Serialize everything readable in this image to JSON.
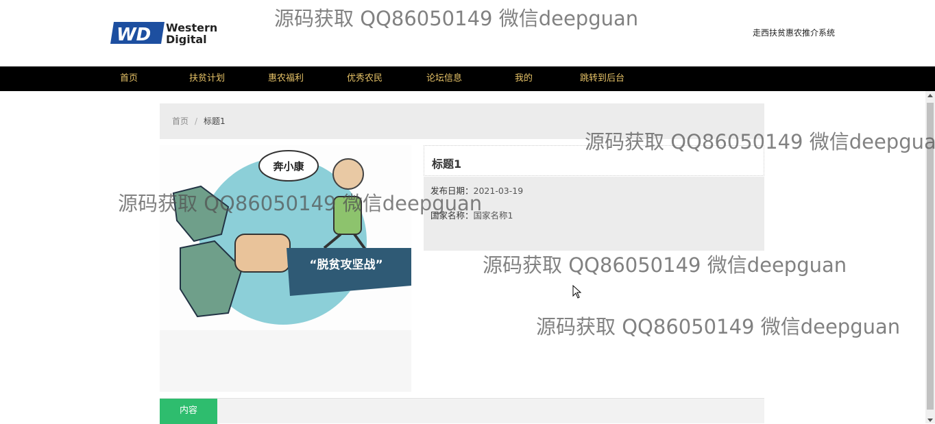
{
  "header": {
    "logo": {
      "line1": "Western",
      "line2": "Digital",
      "mark": "WD"
    },
    "site_title": "走西扶贫惠农推介系统"
  },
  "nav": {
    "items": [
      {
        "label": "首页"
      },
      {
        "label": "扶贫计划"
      },
      {
        "label": "惠农福利"
      },
      {
        "label": "优秀农民"
      },
      {
        "label": "论坛信息"
      },
      {
        "label": "我的"
      },
      {
        "label": "跳转到后台"
      }
    ]
  },
  "breadcrumb": {
    "home": "首页",
    "separator": "/",
    "current": "标题1"
  },
  "image": {
    "bubble_text": "奔小康",
    "banner_text": "“脱贫攻坚战”"
  },
  "detail": {
    "title": "标题1",
    "fields": [
      {
        "label": "发布日期：",
        "value": "2021-03-19"
      },
      {
        "label": "国家名称：",
        "value": "国家名称1"
      }
    ]
  },
  "content_tab": {
    "label": "内容"
  },
  "watermark_text": "源码获取 QQ86050149 微信deepguan",
  "colors": {
    "nav_bg": "#000000",
    "nav_text": "#e8c468",
    "tab_active": "#2ebd6e",
    "breadcrumb_bg": "#ececec"
  }
}
